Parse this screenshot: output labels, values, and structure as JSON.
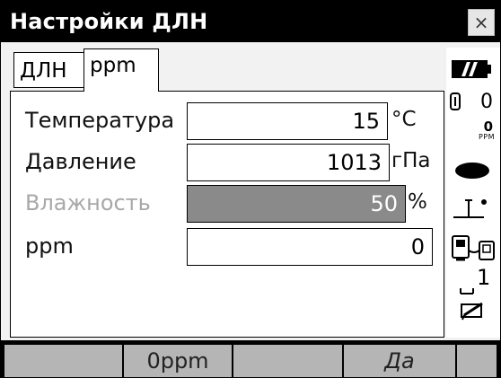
{
  "window": {
    "title": "Настройки ДЛН",
    "close_glyph": "×"
  },
  "tabs": [
    {
      "label": "ДЛН",
      "selected": false
    },
    {
      "label": "ppm",
      "selected": true
    }
  ],
  "form": {
    "rows": [
      {
        "label": "Температура",
        "value": "15",
        "unit": "°C",
        "enabled": true
      },
      {
        "label": "Давление",
        "value": "1013",
        "unit": "гПа",
        "enabled": true
      },
      {
        "label": "Влажность",
        "value": "50",
        "unit": "%",
        "enabled": false
      },
      {
        "label": "ppm",
        "value": "0",
        "unit": "",
        "enabled": true
      }
    ]
  },
  "status": {
    "battery_icon": "battery-icon",
    "prism_constant": "0",
    "ppm_value": "0",
    "ppm_label": "PPM",
    "target_icon": "target-icon",
    "tilt_icon": "tilt-icon",
    "comm_icon": "communication-icon",
    "level_value": "1",
    "edit_icon": "edit-icon"
  },
  "softkeys": [
    "",
    "0ppm",
    "",
    "Да",
    ""
  ]
}
